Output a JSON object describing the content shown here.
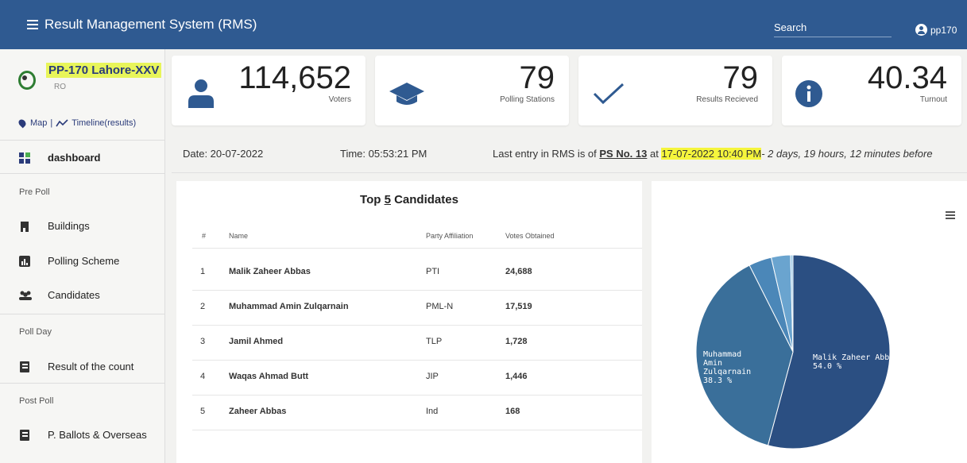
{
  "header": {
    "title": "Result Management System (RMS)",
    "search_placeholder": "Search",
    "user": "pp170"
  },
  "sidebar": {
    "constituency": "PP-170 Lahore-XXV",
    "role": "RO",
    "map_label": "Map",
    "separator": "|",
    "timeline_label": "Timeline(results)",
    "dashboard": "dashboard",
    "sections": {
      "pre_poll": "Pre Poll",
      "poll_day": "Poll Day",
      "post_poll": "Post Poll"
    },
    "items": {
      "buildings": "Buildings",
      "polling_scheme": "Polling Scheme",
      "candidates": "Candidates",
      "result_count": "Result of the count",
      "ballots": "P. Ballots & Overseas"
    }
  },
  "stats": [
    {
      "value": "114,652",
      "label": "Voters",
      "icon": "user-icon"
    },
    {
      "value": "79",
      "label": "Polling Stations",
      "icon": "graduation-cap-icon"
    },
    {
      "value": "79",
      "label": "Results Recieved",
      "icon": "check-icon"
    },
    {
      "value": "40.34",
      "label": "Turnout",
      "icon": "info-icon"
    }
  ],
  "info": {
    "date": "Date: 20-07-2022",
    "time": "Time: 05:53:21 PM",
    "last_entry_prefix": "Last entry in RMS is of ",
    "ps": "PS No. 13",
    "at": " at ",
    "timestamp": "17-07-2022 10:40 PM",
    "ago": "- 2 days, 19 hours, 12 minutes before"
  },
  "table": {
    "title_prefix": "Top ",
    "title_num": "5",
    "title_suffix": " Candidates",
    "headers": [
      "#",
      "Name",
      "Party Affiliation",
      "Votes Obtained"
    ],
    "rows": [
      [
        "1",
        "Malik Zaheer Abbas",
        "PTI",
        "24,688"
      ],
      [
        "2",
        "Muhammad Amin Zulqarnain",
        "PML-N",
        "17,519"
      ],
      [
        "3",
        "Jamil Ahmed",
        "TLP",
        "1,728"
      ],
      [
        "4",
        "Waqas Ahmad Butt",
        "JIP",
        "1,446"
      ],
      [
        "5",
        "Zaheer Abbas",
        "Ind",
        "168"
      ]
    ]
  },
  "chart_data": {
    "type": "pie",
    "slices": [
      {
        "label": "Malik Zaheer Abbas",
        "value": 54.0,
        "color": "#2b4f82"
      },
      {
        "label": "Muhammad Amin Zulqarnain",
        "value": 38.3,
        "color": "#3a6f9a"
      },
      {
        "label": "Jamil Ahmed",
        "value": 3.8,
        "color": "#4b87b8"
      },
      {
        "label": "Waqas Ahmad Butt",
        "value": 3.2,
        "color": "#6aa4cf"
      },
      {
        "label": "Zaheer Abbas",
        "value": 0.4,
        "color": "#9cc8e6"
      }
    ],
    "labels": [
      {
        "name": "Malik Zaheer Abbas",
        "pct": "54.0 %"
      },
      {
        "name": "Muhammad Amin Zulqarnain",
        "pct": "38.3 %"
      }
    ]
  },
  "colors": {
    "topbar": "#2f5a91",
    "highlight": "#f5f53c",
    "constituency_bg": "#e8f55a"
  }
}
